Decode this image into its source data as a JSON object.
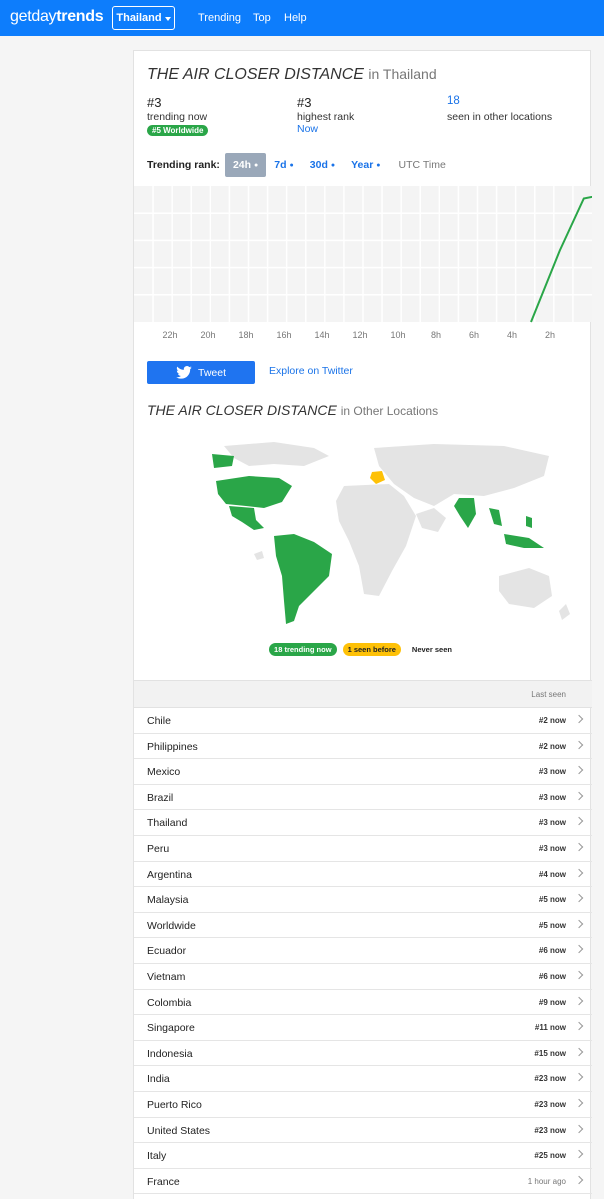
{
  "navbar": {
    "brand_part1": "getday",
    "brand_part2": "trends",
    "country": "Thailand",
    "links": [
      "Trending",
      "Top",
      "Help"
    ]
  },
  "topic": {
    "name": "THE AIR CLOSER DISTANCE",
    "in_location": "in Thailand",
    "in_other": "in Other Locations"
  },
  "stats": {
    "trending_now_rank": "#3",
    "trending_now_label": "trending now",
    "worldwide_badge": "#5 Worldwide",
    "highest_rank": "#3",
    "highest_rank_label": "highest rank",
    "highest_rank_when": "Now",
    "other_locations_count": "18",
    "other_locations_label": "seen in other locations"
  },
  "trending_rank": {
    "label": "Trending rank:",
    "timeframes": [
      "24h",
      "7d",
      "30d",
      "Year"
    ],
    "active": "24h",
    "utc": "UTC Time"
  },
  "chart_data": {
    "type": "line",
    "x_ticks": [
      "22h",
      "20h",
      "18h",
      "16h",
      "14h",
      "12h",
      "10h",
      "8h",
      "6h",
      "4h",
      "2h"
    ],
    "series": [
      {
        "points": [
          [
            -1.2,
            0
          ],
          [
            -0.6,
            0.55
          ],
          [
            -0.1,
            0.95
          ],
          [
            0.6,
            1.0
          ]
        ]
      }
    ],
    "grid": true,
    "color": "#2aa648"
  },
  "actions": {
    "tweet": "Tweet",
    "explore": "Explore on Twitter"
  },
  "map": {
    "trending_color": "#2aa648",
    "seen_color": "#fec107",
    "never_color": "#e4e4e4"
  },
  "legend": {
    "trending": "18 trending now",
    "seen": "1 seen before",
    "never": "Never seen"
  },
  "list": {
    "header": "Last seen",
    "rows": [
      {
        "name": "Chile",
        "rank": "#2 now"
      },
      {
        "name": "Philippines",
        "rank": "#2 now"
      },
      {
        "name": "Mexico",
        "rank": "#3 now"
      },
      {
        "name": "Brazil",
        "rank": "#3 now"
      },
      {
        "name": "Thailand",
        "rank": "#3 now"
      },
      {
        "name": "Peru",
        "rank": "#3 now"
      },
      {
        "name": "Argentina",
        "rank": "#4 now"
      },
      {
        "name": "Malaysia",
        "rank": "#5 now"
      },
      {
        "name": "Worldwide",
        "rank": "#5 now"
      },
      {
        "name": "Ecuador",
        "rank": "#6 now"
      },
      {
        "name": "Vietnam",
        "rank": "#6 now"
      },
      {
        "name": "Colombia",
        "rank": "#9 now"
      },
      {
        "name": "Singapore",
        "rank": "#11 now"
      },
      {
        "name": "Indonesia",
        "rank": "#15 now"
      },
      {
        "name": "India",
        "rank": "#23 now"
      },
      {
        "name": "Puerto Rico",
        "rank": "#23 now"
      },
      {
        "name": "United States",
        "rank": "#23 now"
      },
      {
        "name": "Italy",
        "rank": "#25 now"
      },
      {
        "name": "France",
        "rank": "1 hour ago"
      }
    ]
  }
}
